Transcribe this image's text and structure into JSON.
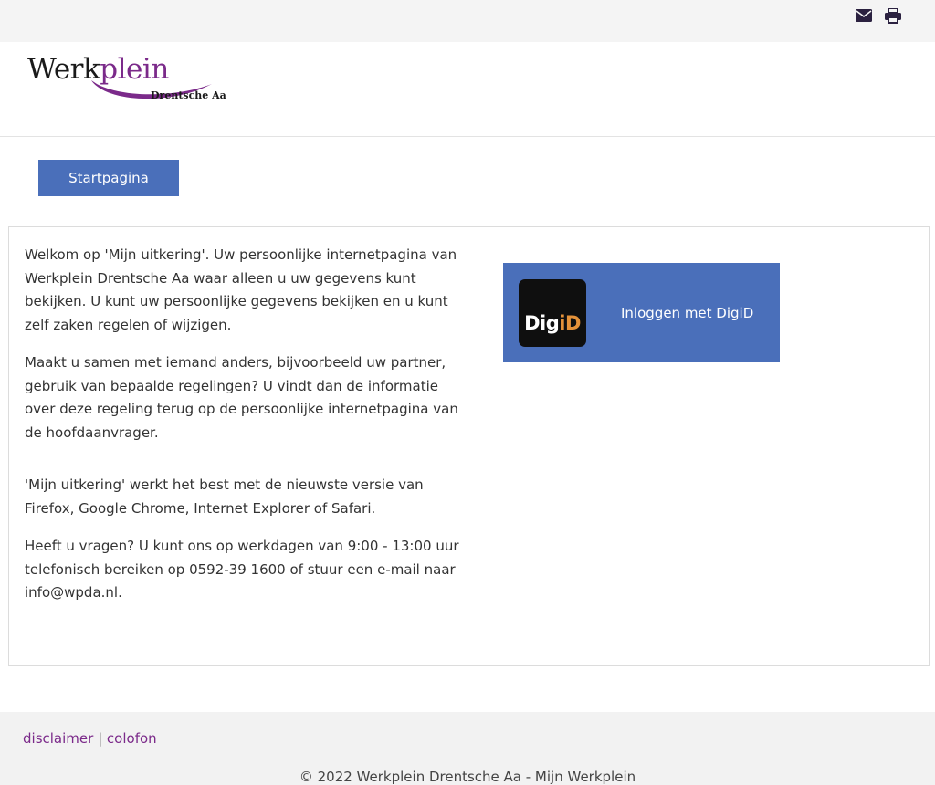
{
  "topbar": {
    "mail_icon": "envelope-icon",
    "print_icon": "printer-icon"
  },
  "logo": {
    "main_part1": "Werk",
    "main_part2": "plein",
    "sub": "Drentsche Aa",
    "colors": {
      "dark": "#1a1a1a",
      "purple": "#7b2a8a"
    }
  },
  "nav": {
    "start_label": "Startpagina"
  },
  "content": {
    "paragraphs": [
      "Welkom op 'Mijn uitkering'. Uw persoonlijke internetpagina van Werkplein Drentsche Aa waar alleen u uw gegevens kunt bekijken. U kunt uw persoonlijke gegevens bekijken en u kunt zelf zaken regelen of wijzigen.",
      "Maakt u samen met iemand anders, bijvoorbeeld uw partner, gebruik van bepaalde regelingen? U vindt dan de informatie over deze regeling terug op de persoonlijke internetpagina van de hoofdaanvrager.",
      "'Mijn uitkering' werkt het best met de nieuwste versie van Firefox, Google Chrome, Internet Explorer of Safari.",
      "Heeft u vragen? U kunt ons op werkdagen van 9:00 - 13:00 uur telefonisch bereiken op 0592-39 1600 of stuur een e-mail naar info@wpda.nl."
    ]
  },
  "digid": {
    "logo_part1": "Dig",
    "logo_part2": "iD",
    "label": "Inloggen met DigiD",
    "colors": {
      "button": "#4a6fba",
      "logo_bg": "#0f0f0f",
      "accent": "#e4923a"
    }
  },
  "footer": {
    "disclaimer": "disclaimer",
    "separator": "|",
    "colofon": "colofon",
    "copyright": "© 2022 Werkplein Drentsche Aa - Mijn Werkplein"
  }
}
